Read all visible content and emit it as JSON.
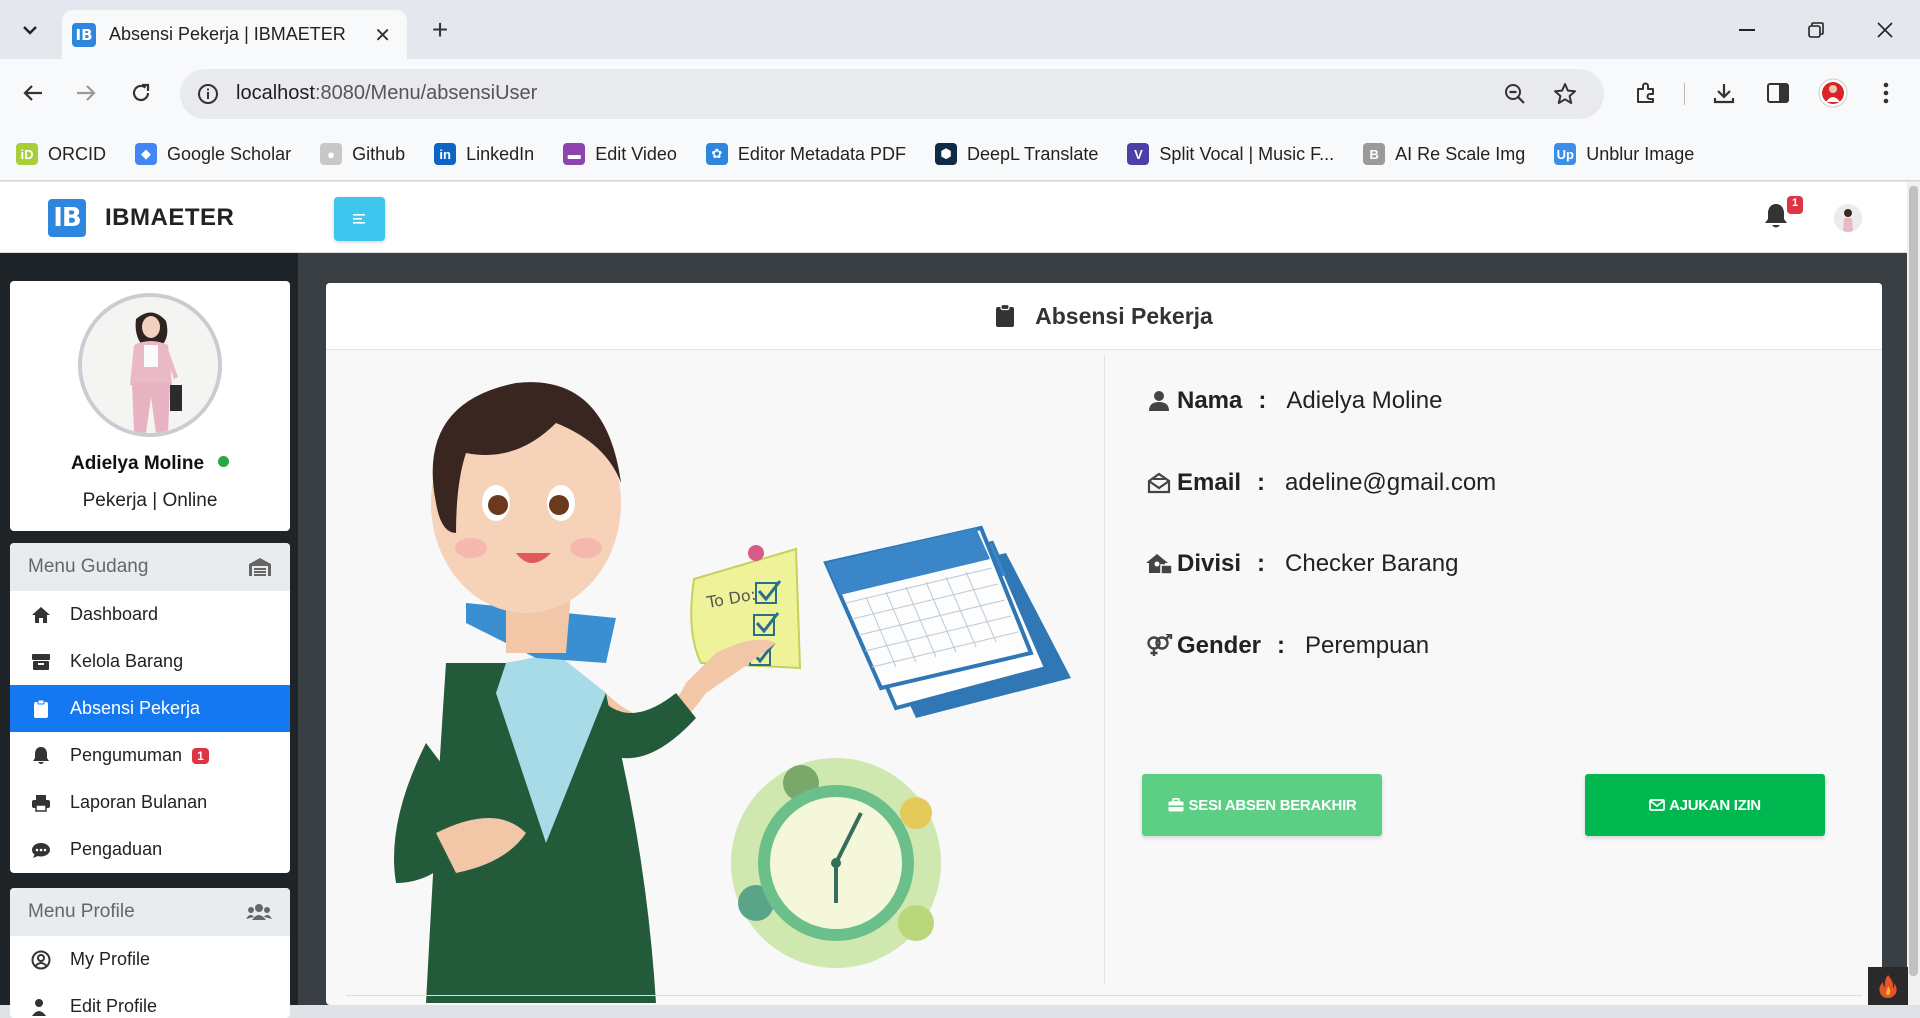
{
  "browser": {
    "tab_title": "Absensi Pekerja | IBMAETER",
    "tab_favicon": "IB",
    "url_host": "localhost",
    "url_rest": ":8080/Menu/absensiUser",
    "bookmarks": [
      {
        "label": "ORCID",
        "icon": "orcid-icon",
        "color": "#a6ce39",
        "glyph": "iD"
      },
      {
        "label": "Google Scholar",
        "icon": "google-scholar-icon",
        "color": "#4285f4",
        "glyph": "◆"
      },
      {
        "label": "Github",
        "icon": "github-icon",
        "color": "#c8c8c8",
        "glyph": "●"
      },
      {
        "label": "LinkedIn",
        "icon": "linkedin-icon",
        "color": "#0a66c2",
        "glyph": "in"
      },
      {
        "label": "Edit Video",
        "icon": "video-icon",
        "color": "#8e44ad",
        "glyph": "▬"
      },
      {
        "label": "Editor Metadata PDF",
        "icon": "pdf-editor-icon",
        "color": "#2e86de",
        "glyph": "✿"
      },
      {
        "label": "DeepL Translate",
        "icon": "deepl-icon",
        "color": "#0f2b46",
        "glyph": "⬢"
      },
      {
        "label": "Split Vocal | Music F...",
        "icon": "split-vocal-icon",
        "color": "#4b3fa8",
        "glyph": "V"
      },
      {
        "label": "AI Re Scale Img",
        "icon": "rescale-icon",
        "color": "#9a9a9a",
        "glyph": "B"
      },
      {
        "label": "Unblur Image",
        "icon": "unblur-icon",
        "color": "#3b8fe8",
        "glyph": "Up"
      }
    ]
  },
  "navbar": {
    "logo_text": "IB",
    "brand": "IBMAETER",
    "notification_count": "1"
  },
  "profile": {
    "name": "Adielya Moline",
    "status": "Pekerja | Online"
  },
  "menu_gudang": {
    "title": "Menu Gudang",
    "items": [
      {
        "label": "Dashboard"
      },
      {
        "label": "Kelola Barang"
      },
      {
        "label": "Absensi Pekerja"
      },
      {
        "label": "Pengumuman",
        "badge": "1"
      },
      {
        "label": "Laporan Bulanan"
      },
      {
        "label": "Pengaduan"
      }
    ]
  },
  "menu_profile": {
    "title": "Menu Profile",
    "items": [
      {
        "label": "My Profile"
      },
      {
        "label": "Edit Profile"
      }
    ]
  },
  "main": {
    "title": "Absensi Pekerja",
    "fields": [
      {
        "label": "Nama",
        "value": "Adielya Moline"
      },
      {
        "label": "Email",
        "value": "adeline@gmail.com"
      },
      {
        "label": "Divisi",
        "value": "Checker Barang"
      },
      {
        "label": "Gender",
        "value": "Perempuan"
      }
    ],
    "illustration_text": "To Do:",
    "btn_sesi": "SESI ABSEN BERAKHIR",
    "btn_izin": "AJUKAN IZIN"
  },
  "colors": {
    "accent": "#1479f0",
    "hamburger": "#3ec6ee",
    "btn_sesi": "#5ccf85",
    "btn_izin": "#00b84f",
    "badge": "#dc3545"
  }
}
